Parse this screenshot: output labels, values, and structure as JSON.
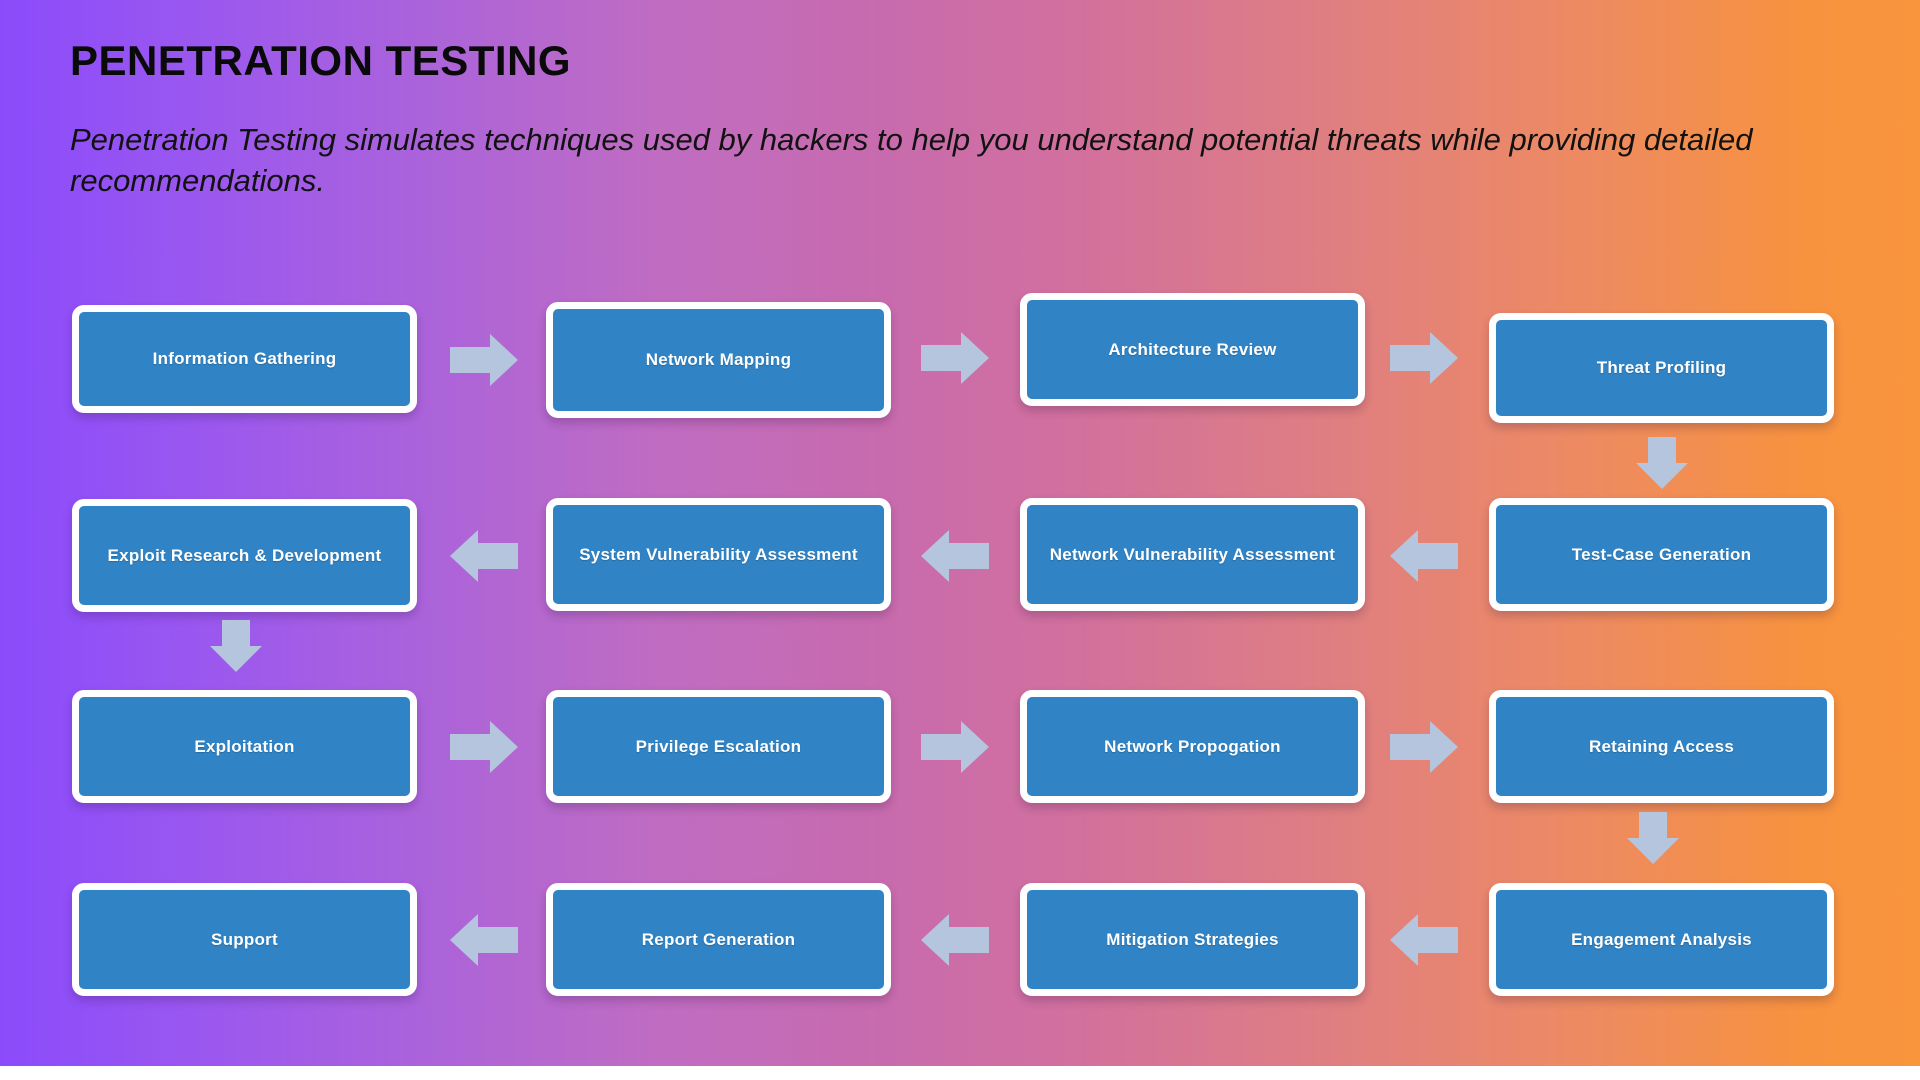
{
  "header": {
    "title": "PENETRATION TESTING",
    "subtitle": "Penetration Testing simulates techniques used by hackers to help you understand potential threats while providing detailed recommendations."
  },
  "theme": {
    "gradient_start": "#8b4bfb",
    "gradient_mid": "#c86bae",
    "gradient_end": "#f7923f",
    "node_fill": "#3083c4",
    "node_border": "#ffffff",
    "node_text": "#ffffff",
    "arrow_fill": "#b4c5dd",
    "title_color": "#0a0a0a"
  },
  "diagram": {
    "type": "process-flow",
    "flow_pattern": "serpentine",
    "rows": 4,
    "columns": 4,
    "nodes": [
      {
        "id": "n1",
        "label": "Information Gathering",
        "row": 1,
        "col": 1
      },
      {
        "id": "n2",
        "label": "Network Mapping",
        "row": 1,
        "col": 2
      },
      {
        "id": "n3",
        "label": "Architecture Review",
        "row": 1,
        "col": 3
      },
      {
        "id": "n4",
        "label": "Threat Profiling",
        "row": 1,
        "col": 4
      },
      {
        "id": "n5",
        "label": "Test-Case Generation",
        "row": 2,
        "col": 4
      },
      {
        "id": "n6",
        "label": "Network Vulnerability Assessment",
        "row": 2,
        "col": 3
      },
      {
        "id": "n7",
        "label": "System Vulnerability Assessment",
        "row": 2,
        "col": 2
      },
      {
        "id": "n8",
        "label": "Exploit Research & Development",
        "row": 2,
        "col": 1
      },
      {
        "id": "n9",
        "label": "Exploitation",
        "row": 3,
        "col": 1
      },
      {
        "id": "n10",
        "label": "Privilege Escalation",
        "row": 3,
        "col": 2
      },
      {
        "id": "n11",
        "label": "Network Propogation",
        "row": 3,
        "col": 3
      },
      {
        "id": "n12",
        "label": "Retaining Access",
        "row": 3,
        "col": 4
      },
      {
        "id": "n13",
        "label": "Engagement Analysis",
        "row": 4,
        "col": 4
      },
      {
        "id": "n14",
        "label": "Mitigation Strategies",
        "row": 4,
        "col": 3
      },
      {
        "id": "n15",
        "label": "Report Generation",
        "row": 4,
        "col": 2
      },
      {
        "id": "n16",
        "label": "Support",
        "row": 4,
        "col": 1
      }
    ],
    "connectors": [
      {
        "from": "n1",
        "to": "n2",
        "direction": "right"
      },
      {
        "from": "n2",
        "to": "n3",
        "direction": "right"
      },
      {
        "from": "n3",
        "to": "n4",
        "direction": "right"
      },
      {
        "from": "n4",
        "to": "n5",
        "direction": "down"
      },
      {
        "from": "n5",
        "to": "n6",
        "direction": "left"
      },
      {
        "from": "n6",
        "to": "n7",
        "direction": "left"
      },
      {
        "from": "n7",
        "to": "n8",
        "direction": "left"
      },
      {
        "from": "n8",
        "to": "n9",
        "direction": "down"
      },
      {
        "from": "n9",
        "to": "n10",
        "direction": "right"
      },
      {
        "from": "n10",
        "to": "n11",
        "direction": "right"
      },
      {
        "from": "n11",
        "to": "n12",
        "direction": "right"
      },
      {
        "from": "n12",
        "to": "n13",
        "direction": "down"
      },
      {
        "from": "n13",
        "to": "n14",
        "direction": "left"
      },
      {
        "from": "n14",
        "to": "n15",
        "direction": "left"
      },
      {
        "from": "n15",
        "to": "n16",
        "direction": "left"
      }
    ]
  }
}
